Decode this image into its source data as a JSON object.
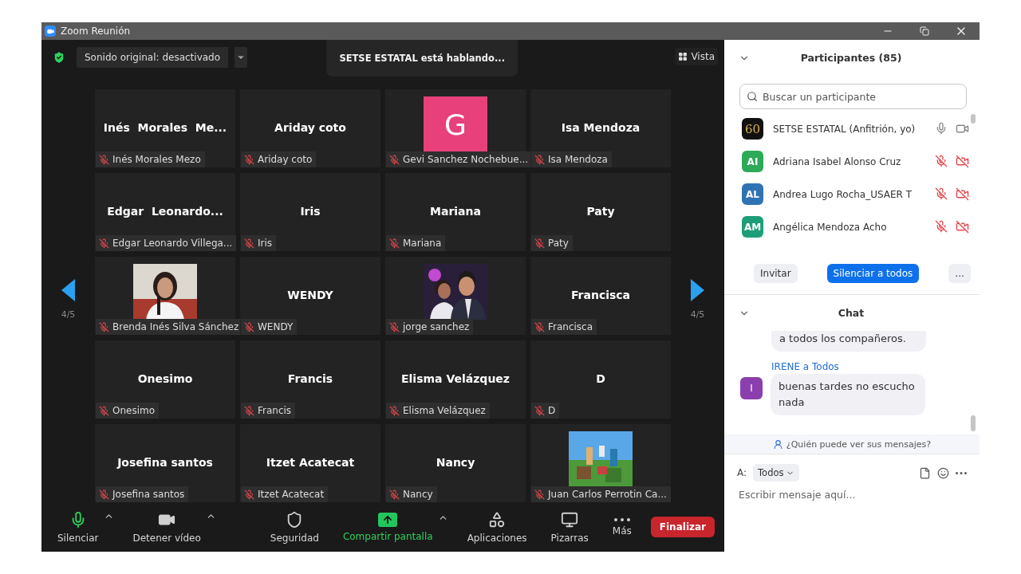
{
  "window": {
    "title": "Zoom Reunión"
  },
  "top_bar": {
    "secure": true,
    "audio_button": "Sonido original: desactivado",
    "speaking_banner": "SETSE ESTATAL está hablando...",
    "view_button": "Vista"
  },
  "pager": {
    "left": "4/5",
    "right": "4/5"
  },
  "tiles": [
    {
      "kind": "name",
      "display": "Inés  Morales  Me...",
      "label": "Inés Morales Mezo",
      "muted": true
    },
    {
      "kind": "name",
      "display": "Ariday coto",
      "label": "Ariday coto",
      "muted": true
    },
    {
      "kind": "avatar",
      "letter": "G",
      "color": "#e8407a",
      "label": "Gevi Sanchez Nochebue...",
      "muted": true
    },
    {
      "kind": "name",
      "display": "Isa Mendoza",
      "label": "Isa Mendoza",
      "muted": true
    },
    {
      "kind": "name",
      "display": "Edgar  Leonardo...",
      "label": "Edgar Leonardo Villega...",
      "muted": true
    },
    {
      "kind": "name",
      "display": "Iris",
      "label": "Iris",
      "muted": true
    },
    {
      "kind": "name",
      "display": "Mariana",
      "label": "Mariana",
      "muted": true
    },
    {
      "kind": "name",
      "display": "Paty",
      "label": "Paty",
      "muted": true
    },
    {
      "kind": "picture",
      "label": "Brenda Inés Silva Sánchez",
      "muted": true
    },
    {
      "kind": "name",
      "display": "WENDY",
      "label": "WENDY",
      "muted": true
    },
    {
      "kind": "picture",
      "label": "jorge sanchez",
      "muted": true
    },
    {
      "kind": "name",
      "display": "Francisca",
      "label": "Francisca",
      "muted": true
    },
    {
      "kind": "name",
      "display": "Onesimo",
      "label": "Onesimo",
      "muted": true
    },
    {
      "kind": "name",
      "display": "Francis",
      "label": "Francis",
      "muted": true
    },
    {
      "kind": "name",
      "display": "Elisma Velázquez",
      "label": "Elisma Velázquez",
      "muted": true
    },
    {
      "kind": "name",
      "display": "D",
      "label": "D",
      "muted": true
    },
    {
      "kind": "name",
      "display": "Josefina santos",
      "label": "Josefina santos",
      "muted": true
    },
    {
      "kind": "name",
      "display": "Itzet Acatecat",
      "label": "Itzet Acatecat",
      "muted": true
    },
    {
      "kind": "name",
      "display": "Nancy",
      "label": "Nancy",
      "muted": true
    },
    {
      "kind": "picture",
      "label": "Juan Carlos Perrotin Ca...",
      "muted": true
    }
  ],
  "toolbar": {
    "items": [
      {
        "kind": "mic",
        "label": "Silenciar",
        "caret": true,
        "active": false
      },
      {
        "kind": "video",
        "label": "Detener vídeo",
        "caret": true,
        "active": false
      },
      {
        "kind": "security",
        "label": "Seguridad",
        "caret": false,
        "active": false
      },
      {
        "kind": "share",
        "label": "Compartir pantalla",
        "caret": true,
        "active": true
      },
      {
        "kind": "apps",
        "label": "Aplicaciones",
        "caret": false,
        "active": false
      },
      {
        "kind": "whiteboard",
        "label": "Pizarras",
        "caret": false,
        "active": false
      },
      {
        "kind": "more",
        "label": "Más",
        "caret": false,
        "active": false
      }
    ],
    "end_button": "Finalizar"
  },
  "participants": {
    "title": "Participantes (85)",
    "search_placeholder": "Buscar un participante",
    "list": [
      {
        "kind": "logo",
        "avatar": "60",
        "name": "SETSE ESTATAL (Anfitrión, yo)",
        "mic_muted": false,
        "video_off": false
      },
      {
        "kind": "initials",
        "avatar": "AI",
        "color": "#2daa58",
        "name": "Adriana Isabel Alonso Cruz",
        "mic_muted": true,
        "video_off": true
      },
      {
        "kind": "initials",
        "avatar": "AL",
        "color": "#2f73b5",
        "name": "Andrea Lugo Rocha_USAER T",
        "mic_muted": true,
        "video_off": true
      },
      {
        "kind": "initials",
        "avatar": "AM",
        "color": "#1e9e78",
        "name": "Angélica Mendoza Acho",
        "mic_muted": true,
        "video_off": true
      }
    ],
    "buttons": [
      {
        "kind": "plain",
        "label": "Invitar"
      },
      {
        "kind": "primary",
        "label": "Silenciar a todos"
      },
      {
        "kind": "plain",
        "label": "..."
      }
    ]
  },
  "chat": {
    "title": "Chat",
    "messages": [
      {
        "text": "a todos los compañeros."
      },
      {
        "header": "IRENE a Todos",
        "avatar": "I",
        "color": "#8b3fae",
        "text": "buenas tardes no escucho nada"
      }
    ],
    "privacy_note": "¿Quién puede ver sus mensajes?",
    "to_label": "A:",
    "recipient": "Todos",
    "placeholder": "Escribir mensaje aquí..."
  }
}
